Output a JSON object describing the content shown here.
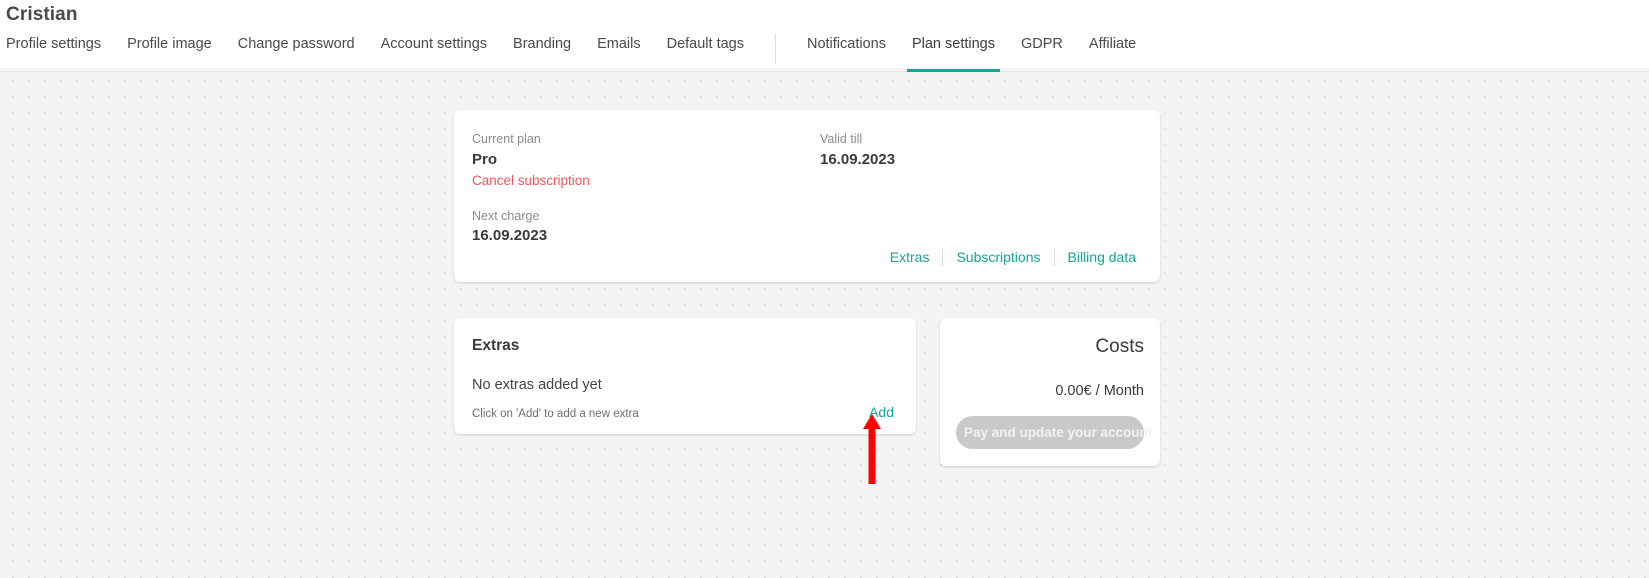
{
  "header": {
    "title": "Cristian",
    "tabs": [
      {
        "label": "Profile settings",
        "active": false
      },
      {
        "label": "Profile image",
        "active": false
      },
      {
        "label": "Change password",
        "active": false
      },
      {
        "label": "Account settings",
        "active": false
      },
      {
        "label": "Branding",
        "active": false
      },
      {
        "label": "Emails",
        "active": false
      },
      {
        "label": "Default tags",
        "active": false
      },
      {
        "label": "Notifications",
        "active": false
      },
      {
        "label": "Plan settings",
        "active": true
      },
      {
        "label": "GDPR",
        "active": false
      },
      {
        "label": "Affiliate",
        "active": false
      }
    ]
  },
  "plan_card": {
    "current_plan_label": "Current plan",
    "current_plan_value": "Pro",
    "cancel_link": "Cancel subscription",
    "next_charge_label": "Next charge",
    "next_charge_value": "16.09.2023",
    "valid_till_label": "Valid till",
    "valid_till_value": "16.09.2023",
    "links": [
      {
        "label": "Extras"
      },
      {
        "label": "Subscriptions"
      },
      {
        "label": "Billing data"
      }
    ]
  },
  "extras_card": {
    "title": "Extras",
    "empty_text": "No extras added yet",
    "hint_text": "Click on 'Add' to add a new extra",
    "add_label": "Add"
  },
  "costs_card": {
    "title": "Costs",
    "amount": "0.00€ / Month",
    "pay_button_label": "Pay and update your account"
  },
  "annotation": {
    "arrow_color": "#ff0000",
    "points_to": "Add"
  },
  "colors": {
    "accent_teal": "#14a697",
    "danger_red": "#f4555a",
    "annotation_red": "#ff0000",
    "canvas_bg": "#f4f4f4",
    "card_bg": "#ffffff"
  }
}
